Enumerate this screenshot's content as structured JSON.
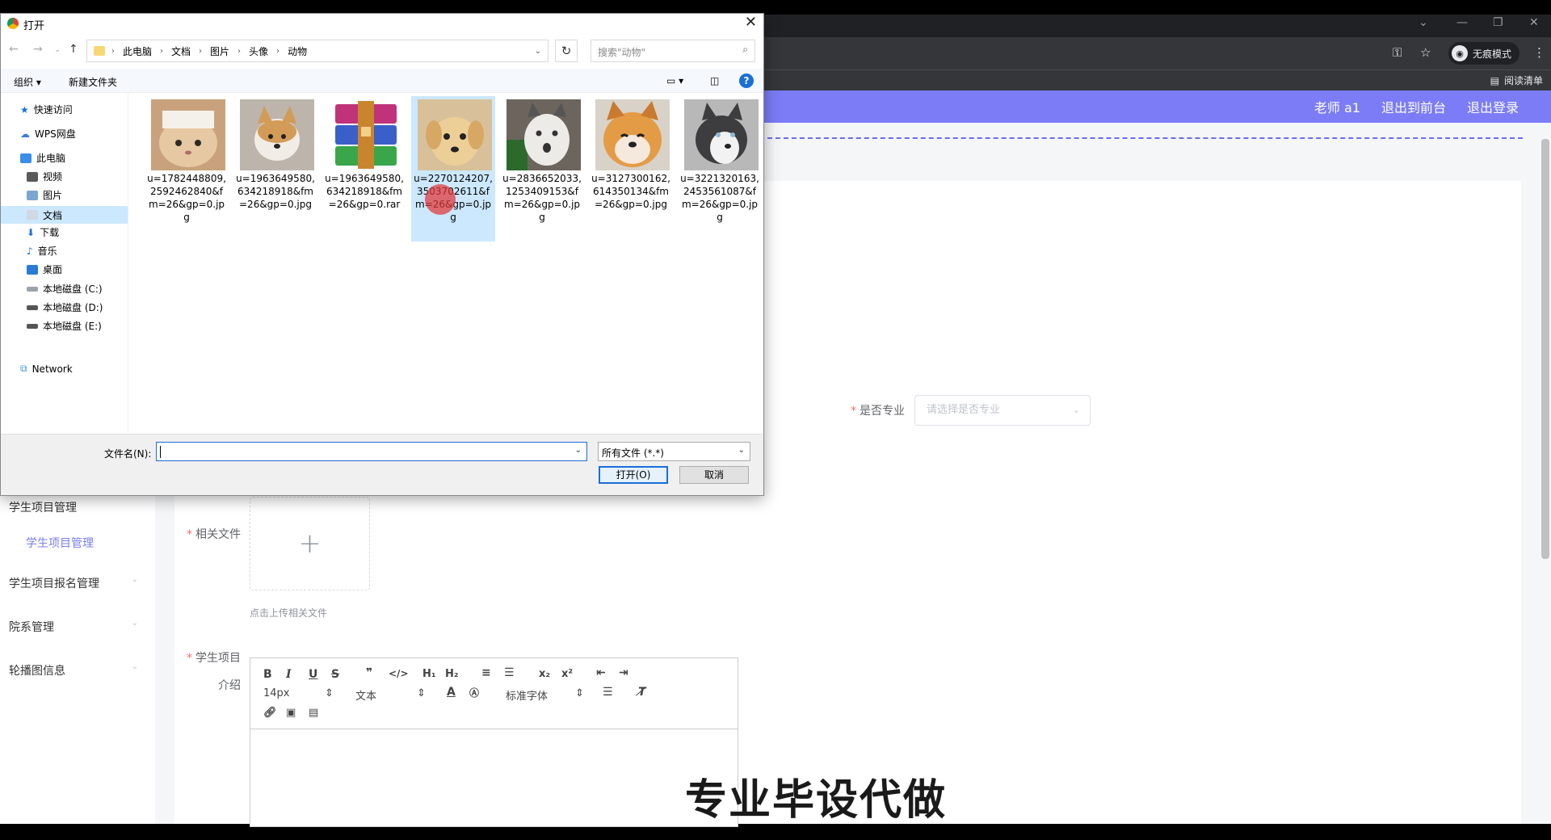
{
  "browser": {
    "incognito_label": "无痕模式",
    "reading_list_label": "阅读清单"
  },
  "app": {
    "nav_links": [
      "老师 a1",
      "退出到前台",
      "退出登录"
    ],
    "sidebar": {
      "top_partial": "学生项目管理",
      "sub_item": "学生项目管理",
      "items": [
        "学生项目报名管理",
        "院系管理",
        "轮播图信息"
      ]
    },
    "form": {
      "major_label": "是否专业",
      "major_placeholder": "请选择是否专业",
      "file_label": "相关文件",
      "upload_tip": "点击上传相关文件",
      "intro_label_1": "学生项目",
      "intro_label_2": "介绍",
      "toolbar": {
        "font_size": "14px",
        "text_style": "文本",
        "font_family": "标准字体"
      }
    },
    "watermark": "专业毕设代做"
  },
  "dialog": {
    "title": "打开",
    "breadcrumb": [
      "此电脑",
      "文档",
      "图片",
      "头像",
      "动物"
    ],
    "search_placeholder": "搜索\"动物\"",
    "organize": "组织 ▾",
    "new_folder": "新建文件夹",
    "nav": {
      "quick_access": "快速访问",
      "wps": "WPS网盘",
      "this_pc": "此电脑",
      "video": "视频",
      "pictures": "图片",
      "documents": "文档",
      "downloads": "下载",
      "music": "音乐",
      "desktop": "桌面",
      "disk_c": "本地磁盘 (C:)",
      "disk_d": "本地磁盘 (D:)",
      "disk_e": "本地磁盘 (E:)",
      "network": "Network"
    },
    "files": [
      {
        "name": "u=1782448809,2592462840&fm=26&gp=0.jpg"
      },
      {
        "name": "u=1963649580,634218918&fm=26&gp=0.jpg"
      },
      {
        "name": "u=1963649580,634218918&fm=26&gp=0.rar"
      },
      {
        "name": "u=2270124207,3503702611&fm=26&gp=0.jpg"
      },
      {
        "name": "u=2836652033,1253409153&fm=26&gp=0.jpg"
      },
      {
        "name": "u=3127300162,614350134&fm=26&gp=0.jpg"
      },
      {
        "name": "u=3221320163,2453561087&fm=26&gp=0.jpg"
      }
    ],
    "filename_label": "文件名(N):",
    "filename_value": "",
    "filetype_value": "所有文件 (*.*)",
    "open_button": "打开(O)",
    "cancel_button": "取消"
  },
  "colors": {
    "accent": "#7b7cf6",
    "selection": "#cce8ff",
    "required": "#f56c6c"
  }
}
